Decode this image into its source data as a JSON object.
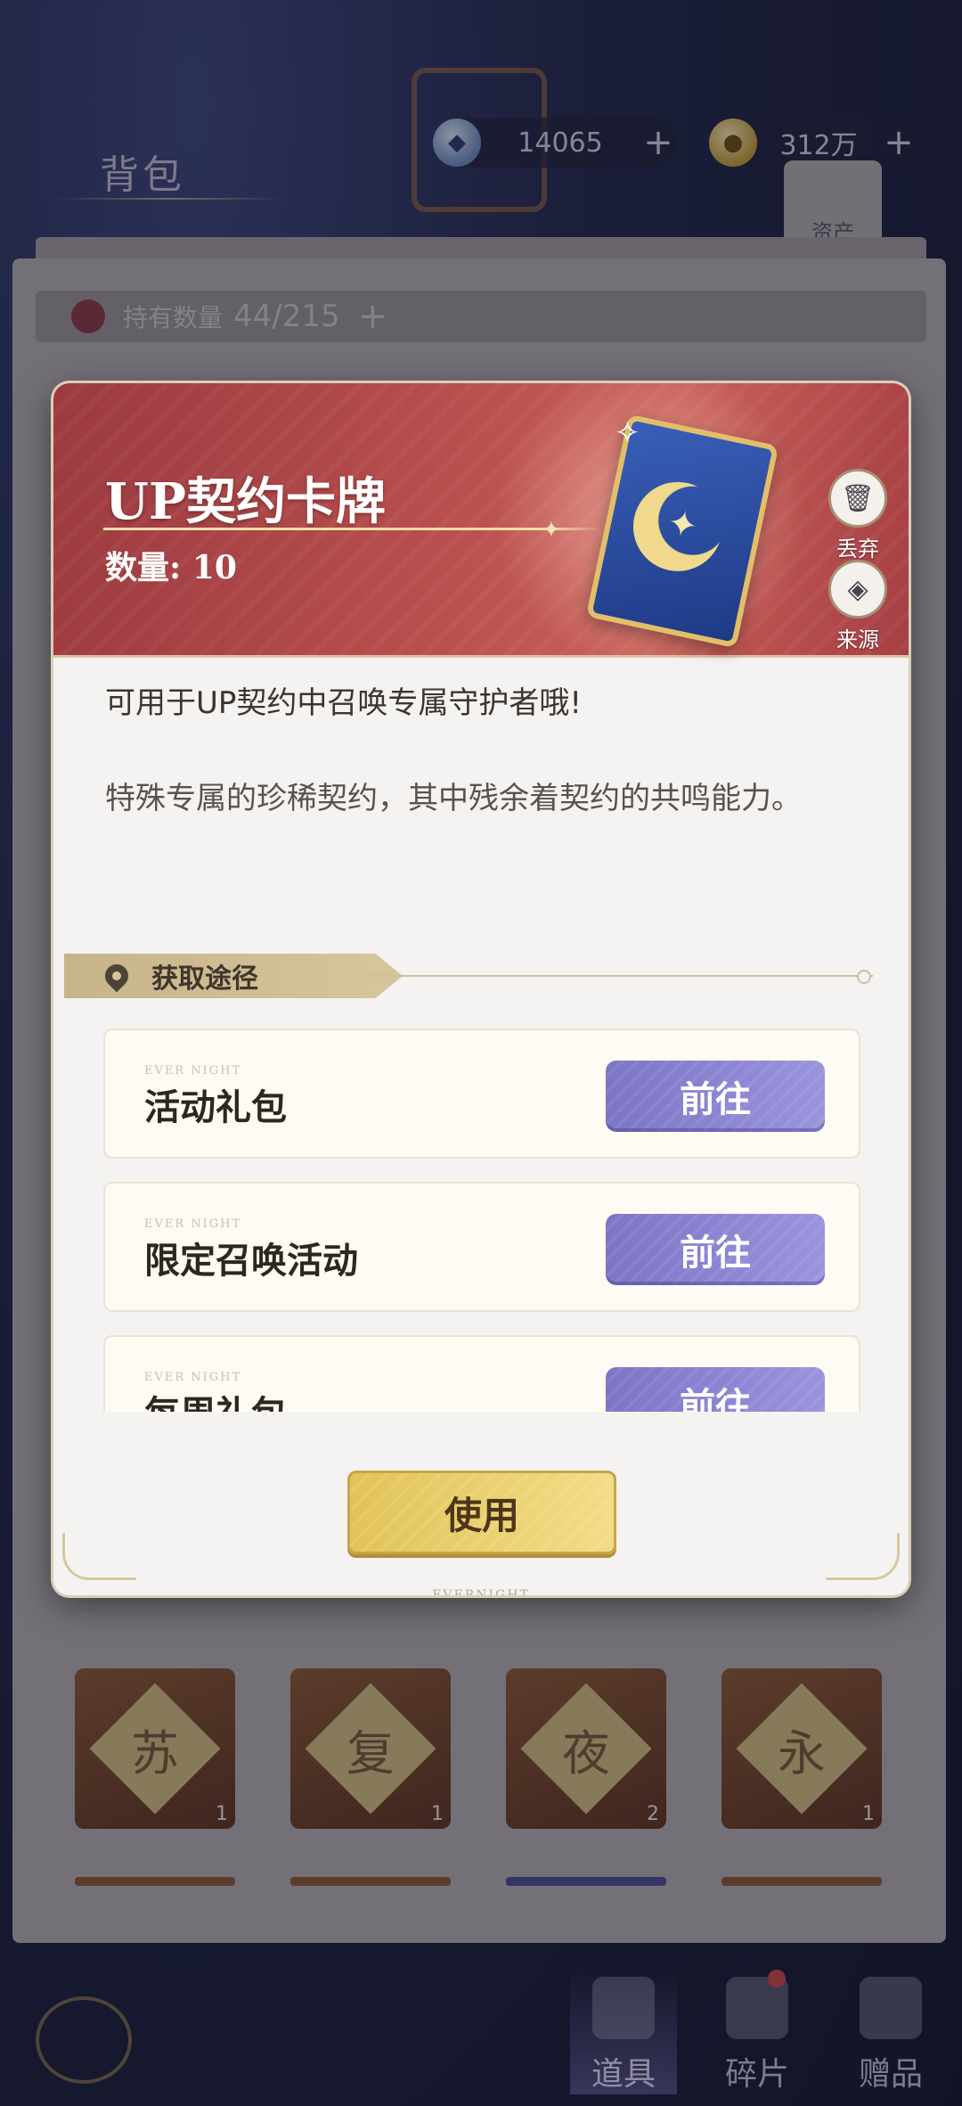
{
  "background": {
    "title": "背包",
    "currency": [
      {
        "icon": "gem-icon",
        "value": "14065",
        "plus": "+"
      },
      {
        "icon": "gold-coin-icon",
        "value": "312万",
        "plus": "+"
      }
    ],
    "asset_label": "资产",
    "hold": {
      "label": "持有数量",
      "value": "44/215",
      "plus": "+"
    },
    "items": [
      {
        "char": "苏",
        "count": "1"
      },
      {
        "char": "复",
        "count": "1"
      },
      {
        "char": "夜",
        "count": "2"
      },
      {
        "char": "永",
        "count": "1"
      }
    ],
    "tabs": [
      {
        "label": "道具",
        "active": true
      },
      {
        "label": "碎片",
        "active": false
      },
      {
        "label": "赠品",
        "active": false
      }
    ]
  },
  "modal": {
    "item_name": "UP契约卡牌",
    "quantity": "数量: 10",
    "discard_label": "丢弃",
    "source_label": "来源",
    "description_1": "可用于UP契约中召唤专属守护者哦!",
    "description_2": "特殊专属的珍稀契约，其中残余着契约的共鸣能力。",
    "obtain_title": "获取途径",
    "sources": [
      {
        "label": "活动礼包",
        "button": "前往"
      },
      {
        "label": "限定召唤活动",
        "button": "前往"
      },
      {
        "label": "每周礼包",
        "button": "前往"
      }
    ],
    "watermark": "EVER NIGHT",
    "use_button": "使用",
    "footer_mark": "EVERNIGHT"
  },
  "colors": {
    "header_red": "#b84e4e",
    "goto_purple": "#8a83d2",
    "use_gold": "#e9cf6e"
  }
}
